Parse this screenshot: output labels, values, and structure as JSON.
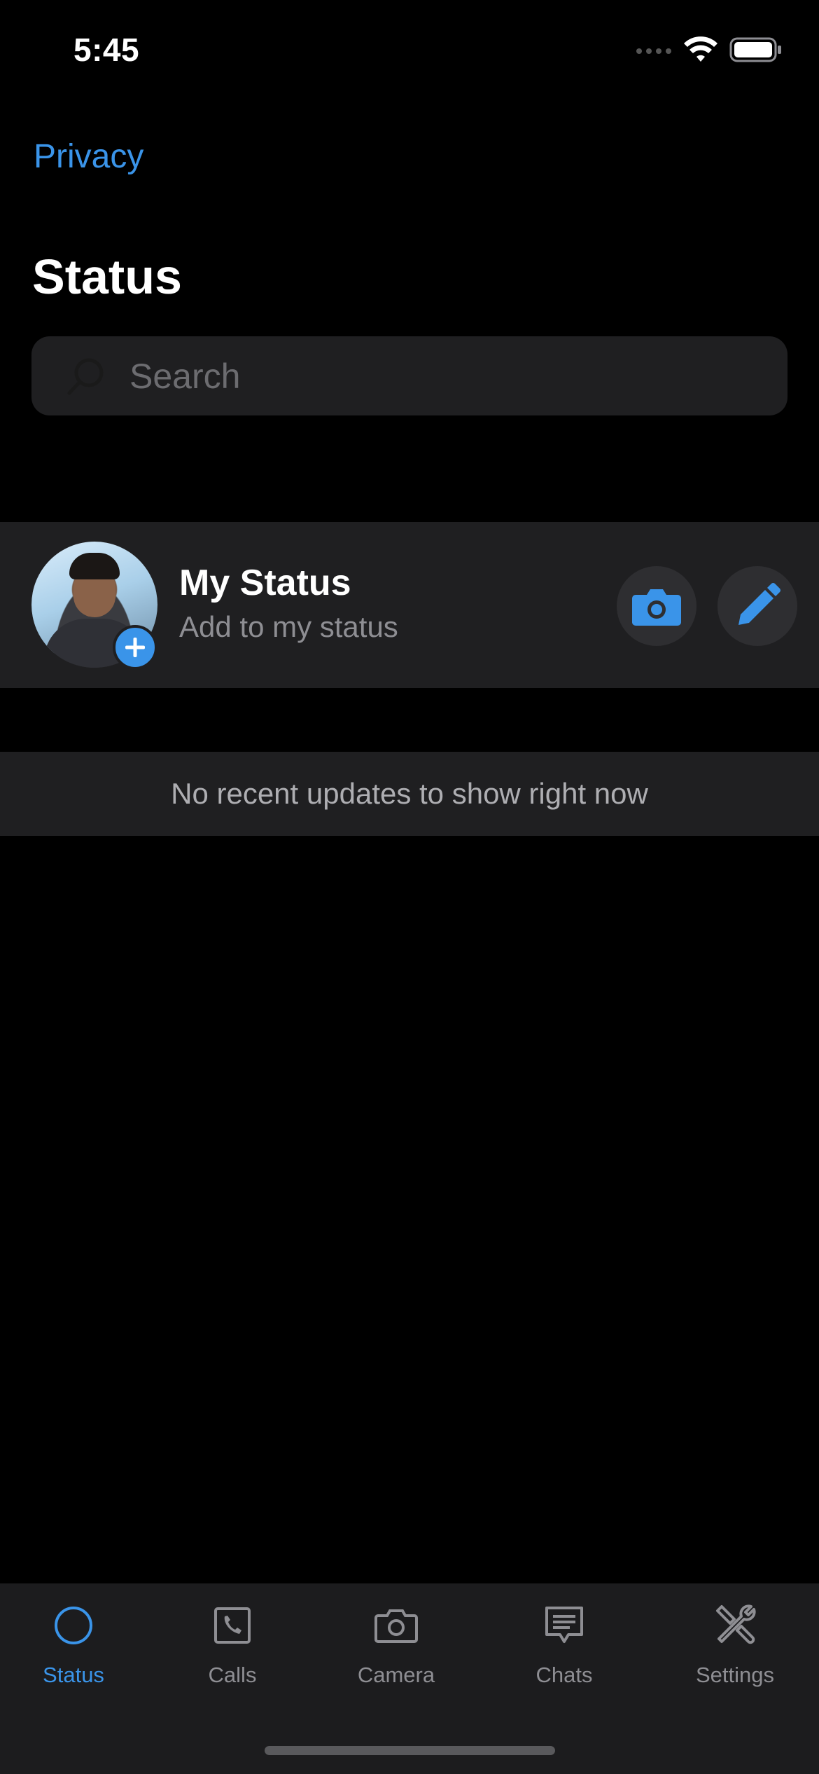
{
  "status_bar": {
    "time": "5:45"
  },
  "nav": {
    "privacy": "Privacy",
    "title": "Status"
  },
  "search": {
    "placeholder": "Search",
    "value": ""
  },
  "my_status": {
    "title": "My Status",
    "subtitle": "Add to my status"
  },
  "empty": {
    "message": "No recent updates to show right now"
  },
  "tabs": [
    {
      "label": "Status",
      "icon": "status-ring-icon",
      "active": true
    },
    {
      "label": "Calls",
      "icon": "phone-icon",
      "active": false
    },
    {
      "label": "Camera",
      "icon": "camera-icon",
      "active": false
    },
    {
      "label": "Chats",
      "icon": "chat-bubble-icon",
      "active": false
    },
    {
      "label": "Settings",
      "icon": "tools-icon",
      "active": false
    }
  ],
  "colors": {
    "accent": "#3a94e9",
    "background": "#000000",
    "row": "#1f1f21",
    "tabbar": "#1c1c1e"
  }
}
